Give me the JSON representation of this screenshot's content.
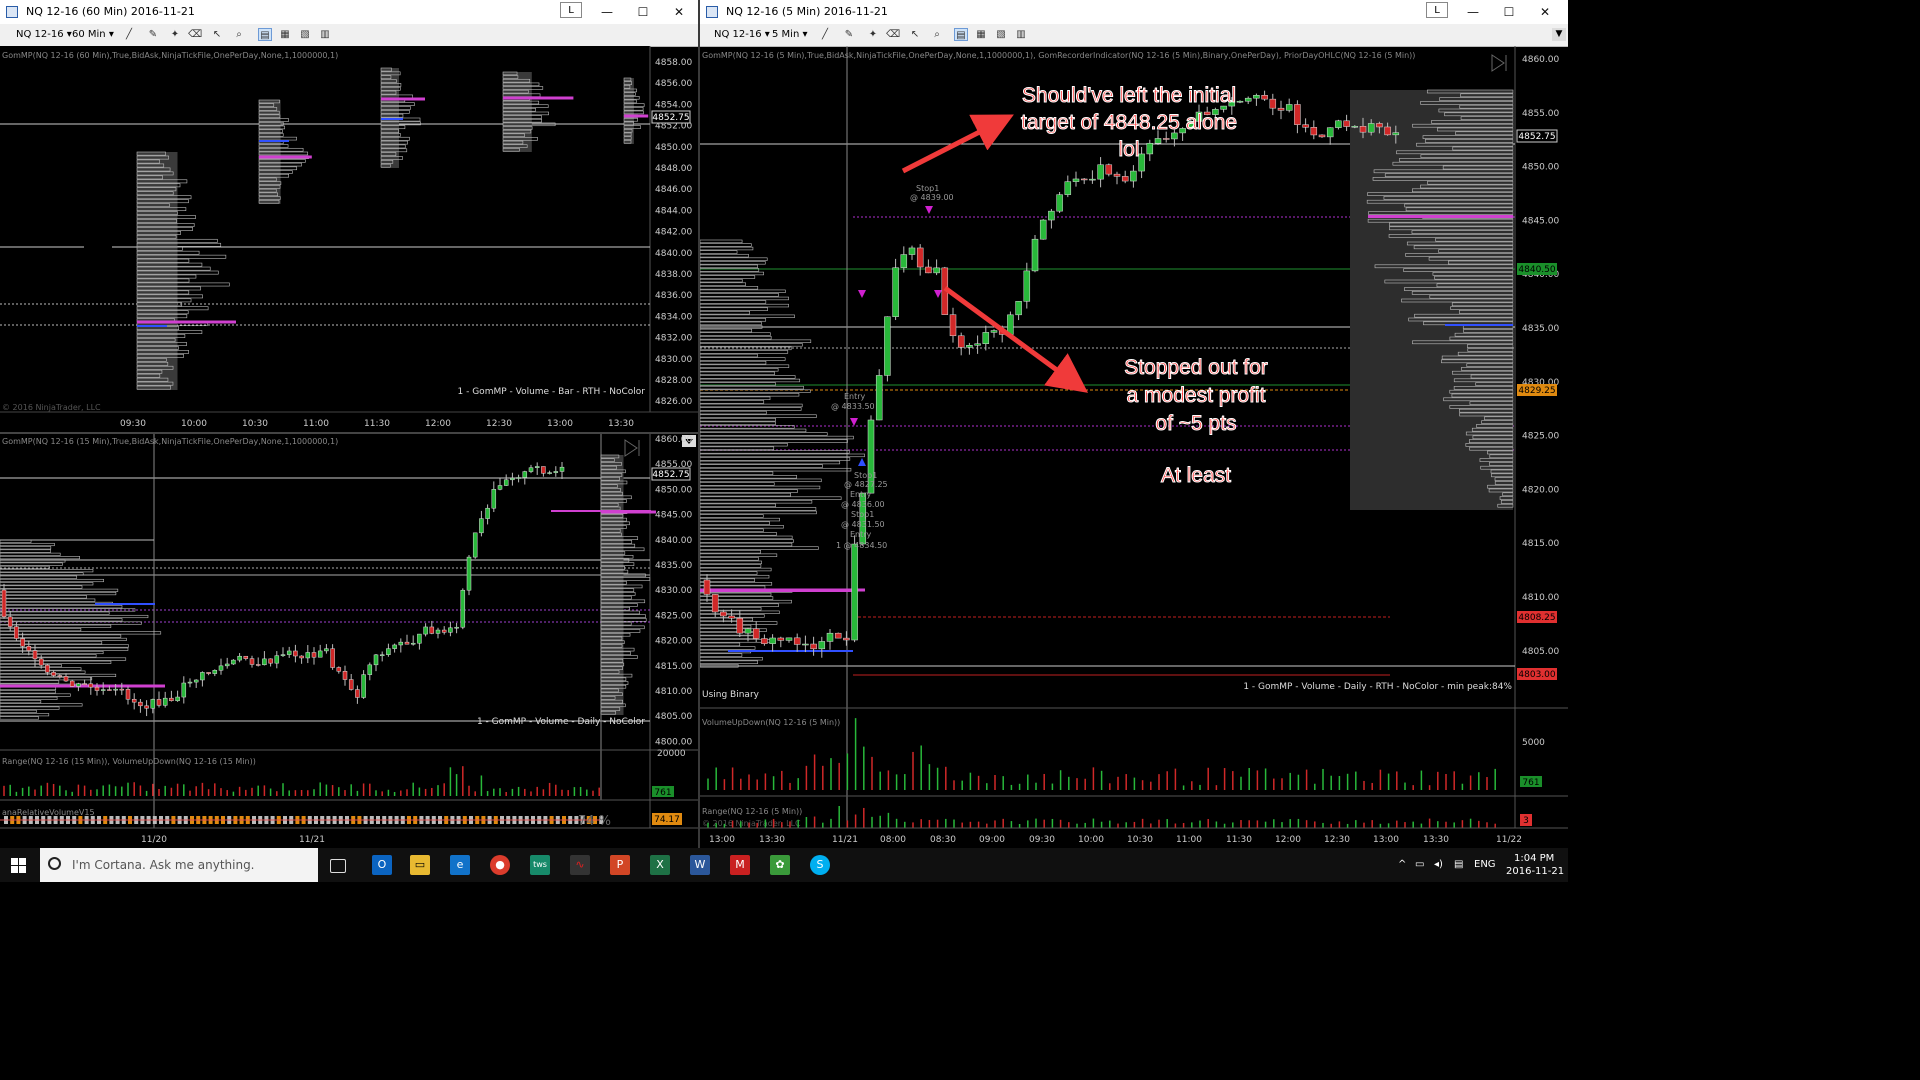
{
  "left_window": {
    "title": "NQ 12-16 (60 Min)  2016-11-21",
    "lock_label": "L",
    "min_label": "—",
    "max_label": "☐",
    "close_label": "✕",
    "instrument": "NQ 12-16 ▾",
    "interval": "60 Min ▾",
    "chart60": {
      "indicator_label": "GomMP(NQ 12-16 (60 Min),True,BidAsk,NinjaTickFile,OnePerDay,None,1,1000000,1)",
      "caption": "1 - GomMP  - Volume - Bar - RTH - NoColor",
      "copyright": "© 2016 NinjaTrader, LLC",
      "price_labels": [
        "4858.00",
        "4856.00",
        "4854.00",
        "4852.00",
        "4850.00",
        "4848.00",
        "4846.00",
        "4844.00",
        "4842.00",
        "4840.00",
        "4838.00",
        "4836.00",
        "4834.00",
        "4832.00",
        "4830.00",
        "4828.00",
        "4826.00"
      ],
      "current_price": "4852.75",
      "time_labels": [
        "09:30",
        "10:00",
        "10:30",
        "11:00",
        "11:30",
        "12:00",
        "12:30",
        "13:00",
        "13:30"
      ]
    },
    "chart15": {
      "indicator_label": "GomMP(NQ 12-16 (15 Min),True,BidAsk,NinjaTickFile,OnePerDay,None,1,1000000,1)",
      "caption": "1 - GomMP  - Volume - Daily - NoColor",
      "price_labels": [
        "4860.00",
        "4855.00",
        "4850.00",
        "4845.00",
        "4840.00",
        "4835.00",
        "4830.00",
        "4825.00",
        "4820.00",
        "4815.00",
        "4810.00",
        "4805.00",
        "4800.00"
      ],
      "current_price": "4852.75",
      "sub1_label": "Range(NQ 12-16 (15 Min)), VolumeUpDown(NQ 12-16 (15 Min))",
      "sub1_value": "20000",
      "sub1_badge": "761",
      "sub2_label": "anaRelativeVolumeV15",
      "sub2_pct": "74 %",
      "sub2_badge": "74.17",
      "time_labels": [
        "11/20",
        "11/21"
      ]
    }
  },
  "right_window": {
    "title": "NQ 12-16 (5 Min)  2016-11-21",
    "lock_label": "L",
    "min_label": "—",
    "max_label": "☐",
    "close_label": "✕",
    "instrument": "NQ 12-16 ▾",
    "interval": "5 Min ▾",
    "chart5": {
      "indicator_label": "GomMP(NQ 12-16 (5 Min),True,BidAsk,NinjaTickFile,OnePerDay,None,1,1000000,1), GomRecorderIndicator(NQ 12-16 (5 Min),Binary,OnePerDay), PriorDayOHLC(NQ 12-16 (5 Min))",
      "price_labels": [
        "4860.00",
        "4855.00",
        "4850.00",
        "4845.00",
        "4840.00",
        "4835.00",
        "4830.00",
        "4825.00",
        "4820.00",
        "4815.00",
        "4810.00",
        "4805.00"
      ],
      "badges": {
        "b1": "4852.75",
        "b2": "4840.50",
        "b3": "4829.25",
        "b4": "4808.25",
        "b5": "4803.00"
      },
      "caption": "1 - GomMP  - Volume - Daily - RTH - NoColor - min peak:84%",
      "using_binary": "Using Binary",
      "orders": {
        "stop1_top": "Stop1",
        "stop1_top_price": "@ 4839.00",
        "entry_a": "Entry",
        "entry_a_price": "@ 4833.50",
        "stop1_b": "Stop1",
        "stop1_b_price": "@ 4827.25",
        "entry_b": "Entry",
        "entry_b_price": "@ 4836.00",
        "stop1_c": "Stop1",
        "stop1_c_price": "@ 4831.50",
        "entry_c": "Entry",
        "entry_c_price": "1 @ 4834.50"
      },
      "annotations": {
        "a1_line1": "Should've left the initial",
        "a1_line2": "target of 4848.25 alone",
        "a1_line3": "lol",
        "a2_line1": "Stopped out for",
        "a2_line2": "a modest profit",
        "a2_line3": "of ~5 pts",
        "a3": "At least"
      },
      "vol_label": "VolumeUpDown(NQ 12-16 (5 Min))",
      "vol_scale": "5000",
      "vol_badge": "761",
      "range_label": "Range(NQ 12-16 (5 Min))",
      "range_copyright": "© 2016 NinjaTrader, LLC",
      "range_badge": "3",
      "time_labels": [
        "13:00",
        "13:30",
        "11/21",
        "08:00",
        "08:30",
        "09:00",
        "09:30",
        "10:00",
        "10:30",
        "11:00",
        "11:30",
        "12:00",
        "12:30",
        "13:00",
        "13:30",
        "11/22"
      ]
    }
  },
  "taskbar": {
    "cortana_text": "I'm Cortana. Ask me anything.",
    "lang": "ENG",
    "time": "1:04 PM",
    "date": "2016-11-21",
    "apps": [
      "task-view",
      "outlook",
      "explorer",
      "edge",
      "chrome",
      "tws",
      "app-red",
      "powerpoint",
      "excel",
      "word",
      "app-m",
      "app-green",
      "skype"
    ]
  }
}
